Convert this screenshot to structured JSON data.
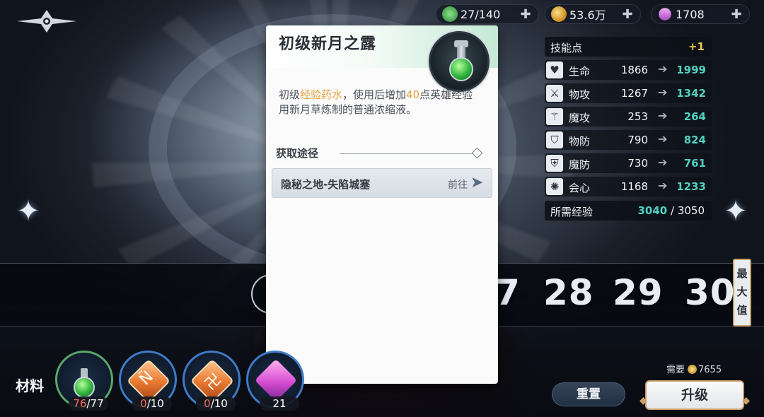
{
  "resources": {
    "stamina": "27/140",
    "gold": "53.6万",
    "gems": "1708"
  },
  "level_strip": {
    "partial_digit": "7",
    "levels": [
      "28",
      "29",
      "30"
    ],
    "max_button": "最大值"
  },
  "item_popup": {
    "title": "初级新月之露",
    "desc_prefix": "初级",
    "desc_highlight_1": "经验药水",
    "desc_mid": "，使用后增加",
    "desc_highlight_2": "40",
    "desc_suffix": "点英雄经验",
    "desc_line2": "用新月草炼制的普通浓缩液。",
    "source_heading": "获取途径",
    "source_name": "隐秘之地-失陷城塞",
    "source_go": "前往"
  },
  "stats": {
    "skill_points_label": "技能点",
    "skill_points_value": "+1",
    "rows": [
      {
        "name": "生命",
        "current": "1866",
        "next": "1999",
        "icon": "heart-icon"
      },
      {
        "name": "物攻",
        "current": "1267",
        "next": "1342",
        "icon": "sword-icon"
      },
      {
        "name": "魔攻",
        "current": "253",
        "next": "264",
        "icon": "staff-icon"
      },
      {
        "name": "物防",
        "current": "790",
        "next": "824",
        "icon": "shield-icon"
      },
      {
        "name": "魔防",
        "current": "730",
        "next": "761",
        "icon": "magic-shield-icon"
      },
      {
        "name": "会心",
        "current": "1168",
        "next": "1233",
        "icon": "crit-icon"
      }
    ],
    "exp_label": "所需经验",
    "exp_current": "3040",
    "exp_total": " / 3050"
  },
  "materials": {
    "label": "材料",
    "slots": [
      {
        "have": "76",
        "need": "/77",
        "type": "potion"
      },
      {
        "have": "0",
        "need": "/10",
        "type": "rune",
        "rune": "Ñ"
      },
      {
        "have": "0",
        "need": "/10",
        "type": "rune",
        "rune": "卍"
      },
      {
        "have": "21",
        "need": "",
        "type": "pink-gem"
      }
    ]
  },
  "footer": {
    "cost_label": "需要",
    "cost_value": "7655",
    "reset_label": "重置",
    "upgrade_label": "升级"
  },
  "colors": {
    "teal_value": "#52d0c0",
    "gold_accent": "#f5c94a",
    "highlight_orange": "#e8a23c",
    "low_red": "#ff6a5e"
  }
}
